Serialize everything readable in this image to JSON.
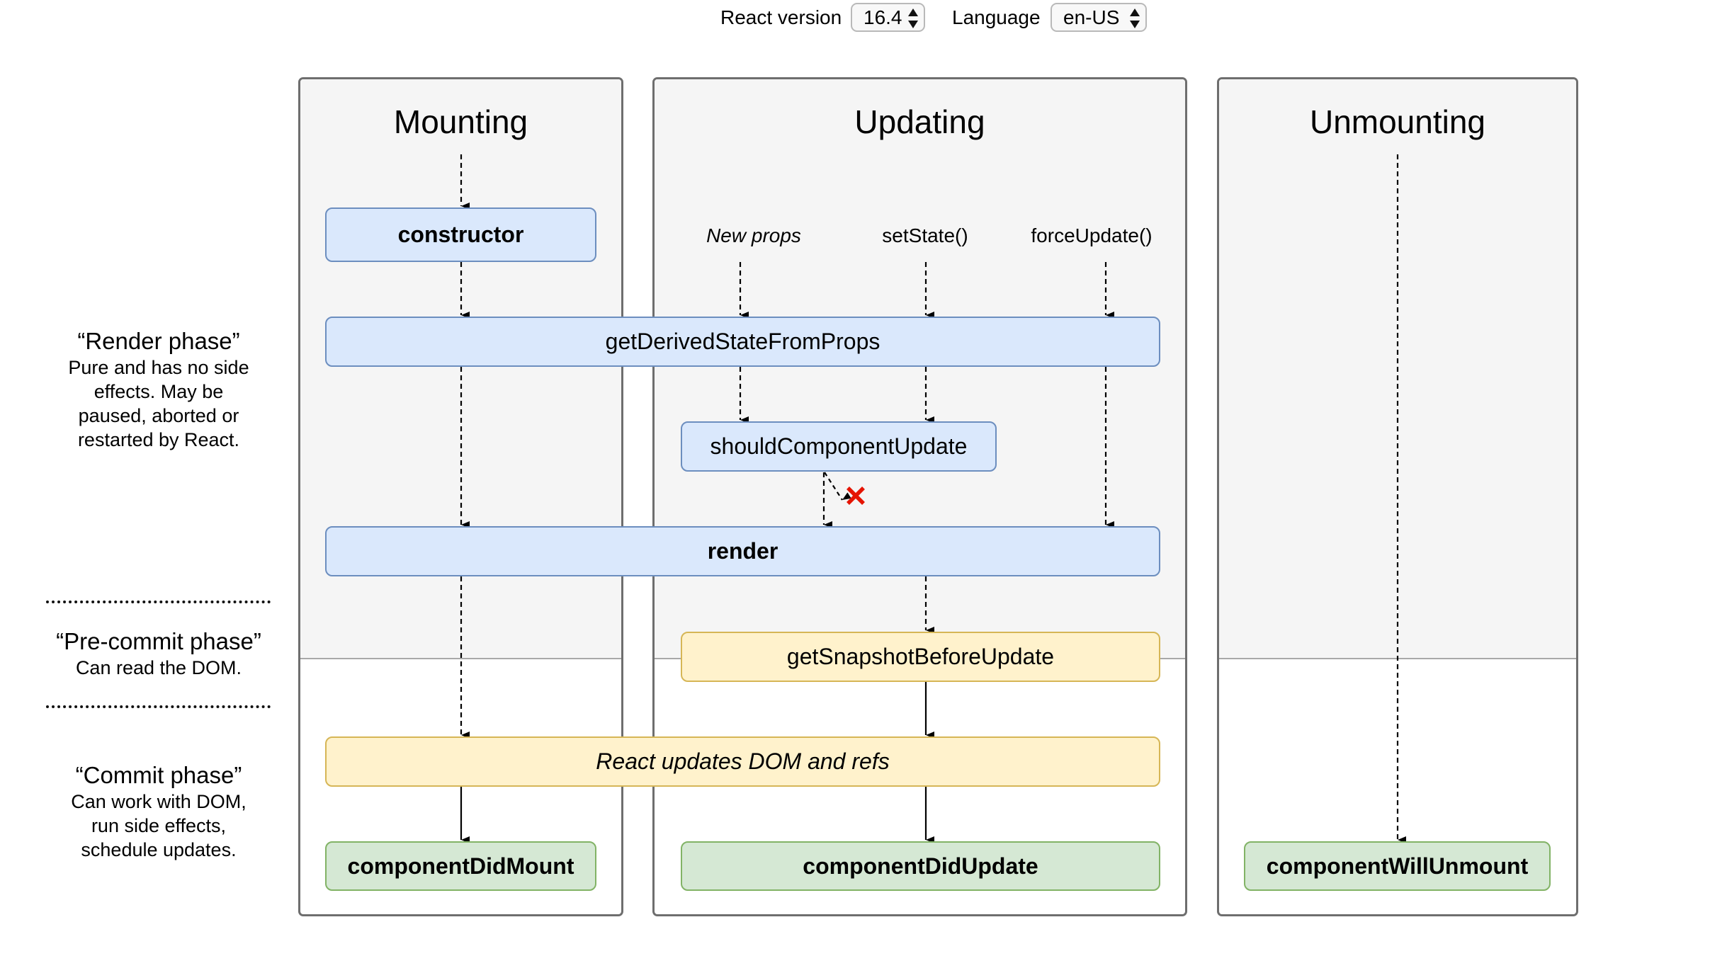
{
  "controls": {
    "react_version_label": "React version",
    "react_version_value": "16.4",
    "language_label": "Language",
    "language_value": "en-US"
  },
  "columns": {
    "mounting": {
      "title": "Mounting"
    },
    "updating": {
      "title": "Updating"
    },
    "unmounting": {
      "title": "Unmounting"
    }
  },
  "triggers": {
    "new_props": "New props",
    "set_state": "setState()",
    "force_update": "forceUpdate()"
  },
  "methods": {
    "constructor": "constructor",
    "get_derived_state_from_props": "getDerivedStateFromProps",
    "should_component_update": "shouldComponentUpdate",
    "render": "render",
    "get_snapshot_before_update": "getSnapshotBeforeUpdate",
    "react_updates_dom": "React updates DOM and refs",
    "component_did_mount": "componentDidMount",
    "component_did_update": "componentDidUpdate",
    "component_will_unmount": "componentWillUnmount"
  },
  "phases": {
    "render": {
      "title": "“Render phase”",
      "lines": [
        "Pure and has no side",
        "effects. May be",
        "paused, aborted or",
        "restarted by React."
      ]
    },
    "pre_commit": {
      "title": "“Pre-commit phase”",
      "lines": [
        "Can read the DOM."
      ]
    },
    "commit": {
      "title": "“Commit phase”",
      "lines": [
        "Can work with DOM,",
        "run side effects,",
        "schedule updates."
      ]
    }
  },
  "icons": {
    "cancel_mark": "red-x-icon"
  },
  "colors": {
    "render_phase_fill": "#dae8fc",
    "render_phase_border": "#6c8ebf",
    "precommit_fill": "#fff2cc",
    "precommit_border": "#d6b656",
    "commit_fill": "#d5e8d4",
    "commit_border": "#82b366",
    "cancel_red": "#e51400"
  }
}
